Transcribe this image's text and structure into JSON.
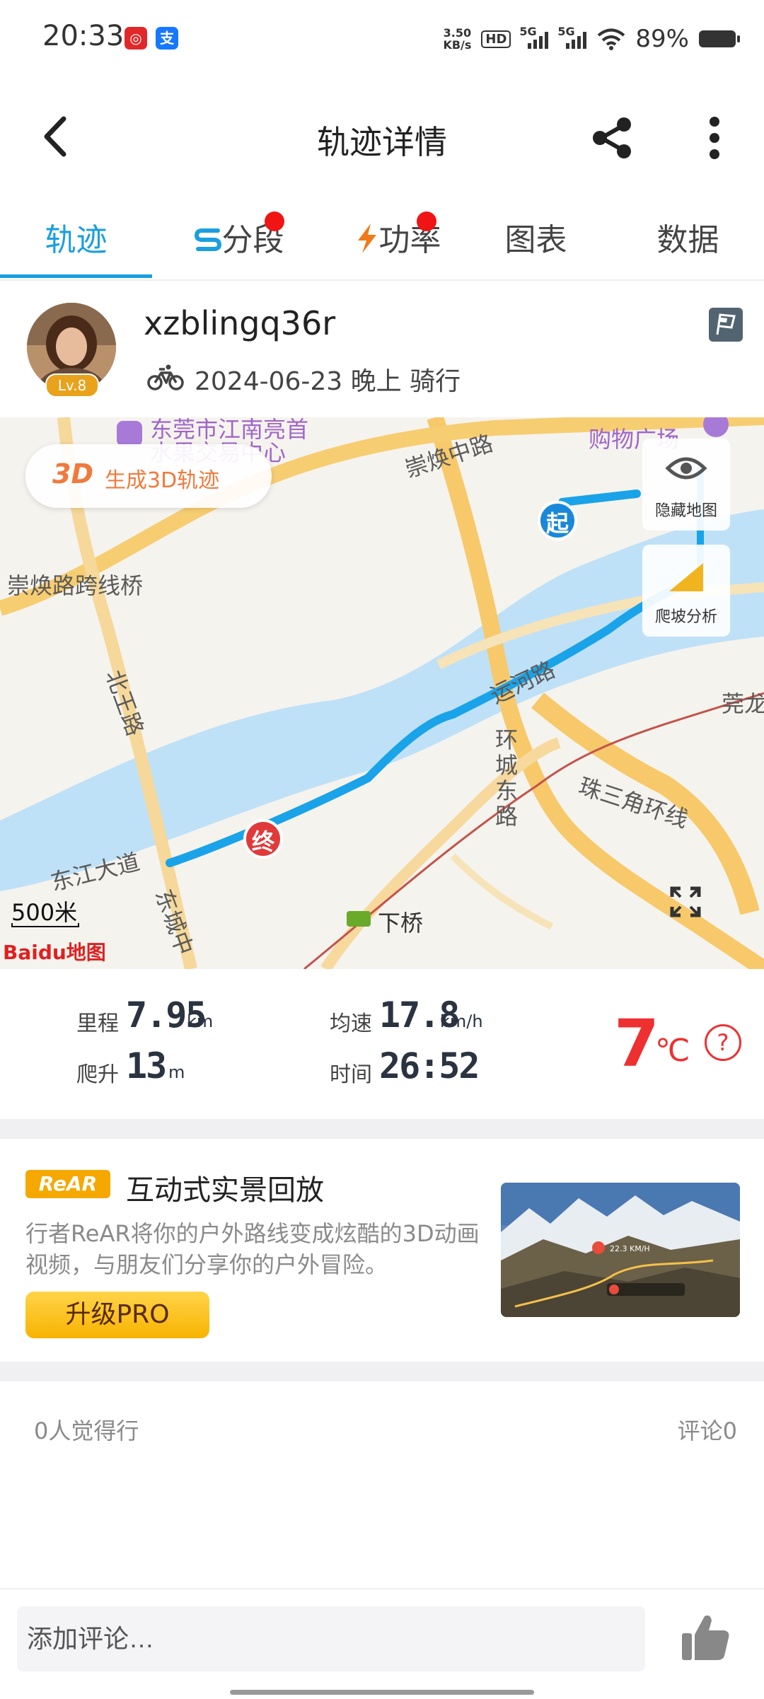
{
  "status_bar": {
    "time": "20:33",
    "net_speed_value": "3.50",
    "net_speed_unit": "KB/s",
    "hd_label": "HD",
    "signal1_label": "5G",
    "signal2_label": "5G",
    "battery_percent": "89%",
    "app_icons": [
      "netease-music-icon",
      "alipay-icon"
    ]
  },
  "header": {
    "title": "轨迹详情",
    "icons": [
      "back-arrow-icon",
      "share-icon",
      "more-vertical-icon"
    ]
  },
  "tabs": [
    {
      "label": "轨迹",
      "active": true
    },
    {
      "label": "分段",
      "badge": true,
      "icon": "segment-icon"
    },
    {
      "label": "功率",
      "badge": true,
      "icon": "lightning-icon"
    },
    {
      "label": "图表"
    },
    {
      "label": "数据"
    }
  ],
  "user": {
    "name": "xzblingq36r",
    "level": "Lv.8",
    "date": "2024-06-23",
    "period": "晚上",
    "activity": "骑行"
  },
  "map": {
    "btn_3d_logo": "3D",
    "btn_3d_label": "生成3D轨迹",
    "hide_map_label": "隐藏地图",
    "climb_label": "爬坡分析",
    "scale": "500米",
    "start_marker": "起",
    "end_marker": "终",
    "labels": {
      "poi_top": "东莞市江南亮首",
      "poi_top2": "水果交易中心",
      "road_chonghuan": "崇焕中路",
      "shopping": "购物广场",
      "bridge": "崇焕路跨线桥",
      "beiwang": "北王路",
      "yunhe": "运河路",
      "huancheng": "环城东路",
      "zhusanjiao": "珠三角环线",
      "wan": "莞龙",
      "dongjiang": "东江大道",
      "dongcheng": "东城中",
      "xiaqiao": "下桥",
      "baidu": "Baidu地图"
    }
  },
  "stats": {
    "distance_label": "里程",
    "distance_value": "7.95",
    "distance_unit": "km",
    "speed_label": "均速",
    "speed_value": "17.8",
    "speed_unit": "km/h",
    "climb_label": "爬升",
    "climb_value": "13",
    "climb_unit": "m",
    "time_label": "时间",
    "time_value": "26:52",
    "temperature": "7",
    "temperature_unit": "℃",
    "help": "?"
  },
  "promo": {
    "logo": "ReAR",
    "title": "互动式实景回放",
    "desc": "行者ReAR将你的户外路线变成炫酷的3D动画视频，与朋友们分享你的户外冒险。",
    "button": "升级PRO",
    "thumb_speed": "22.3 KM/H"
  },
  "social": {
    "likes": "0人觉得行",
    "comments": "评论0"
  },
  "bottom": {
    "comment_placeholder": "添加评论…"
  },
  "colors": {
    "accent": "#1a9fe0",
    "badge_red": "#f01414",
    "temperature": "#ef3030",
    "route": "#1aa3e8",
    "pro_yellow": "#f7b300"
  }
}
